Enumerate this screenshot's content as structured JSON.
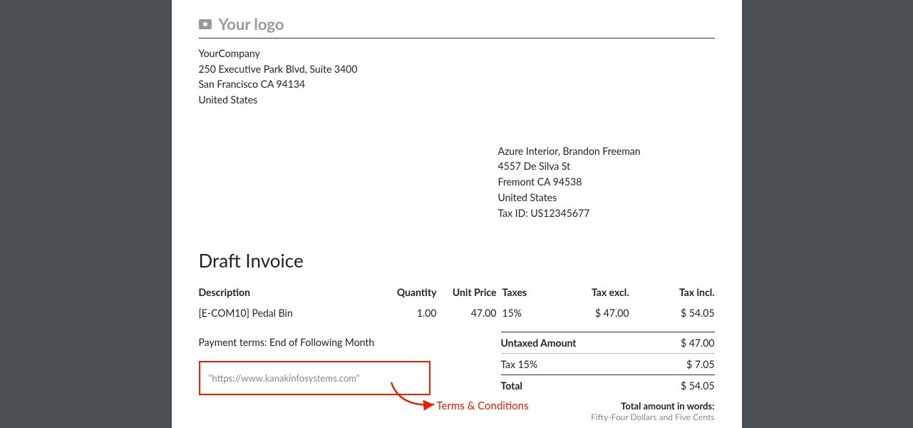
{
  "logo_placeholder": "Your logo",
  "company": {
    "name": "YourCompany",
    "street": "250 Executive Park Blvd, Suite 3400",
    "city_line": "San Francisco CA 94134",
    "country": "United States"
  },
  "customer": {
    "name": "Azure Interior, Brandon Freeman",
    "street": "4557 De Silva St",
    "city_line": "Fremont CA 94538",
    "country": "United States",
    "tax_id": "Tax ID: US12345677"
  },
  "title": "Draft Invoice",
  "headers": {
    "description": "Description",
    "quantity": "Quantity",
    "unit_price": "Unit Price",
    "taxes": "Taxes",
    "tax_excl": "Tax excl.",
    "tax_incl": "Tax incl."
  },
  "lines": [
    {
      "description": "[E-COM10] Pedal Bin",
      "quantity": "1.00",
      "unit_price": "47.00",
      "taxes": "15%",
      "tax_excl": "$ 47.00",
      "tax_incl": "$ 54.05"
    }
  ],
  "payment_terms": "Payment terms: End of Following Month",
  "tc_url": "\"https://www.kanakinfosystems.com\"",
  "totals": {
    "untaxed_label": "Untaxed Amount",
    "untaxed_value": "$ 47.00",
    "tax_label": "Tax 15%",
    "tax_value": "$ 7.05",
    "total_label": "Total",
    "total_value": "$ 54.05"
  },
  "amount_words": {
    "label": "Total amount in words:",
    "value": "Fifty-Four Dollars and Five Cents"
  },
  "annotation": "Terms & Conditions"
}
